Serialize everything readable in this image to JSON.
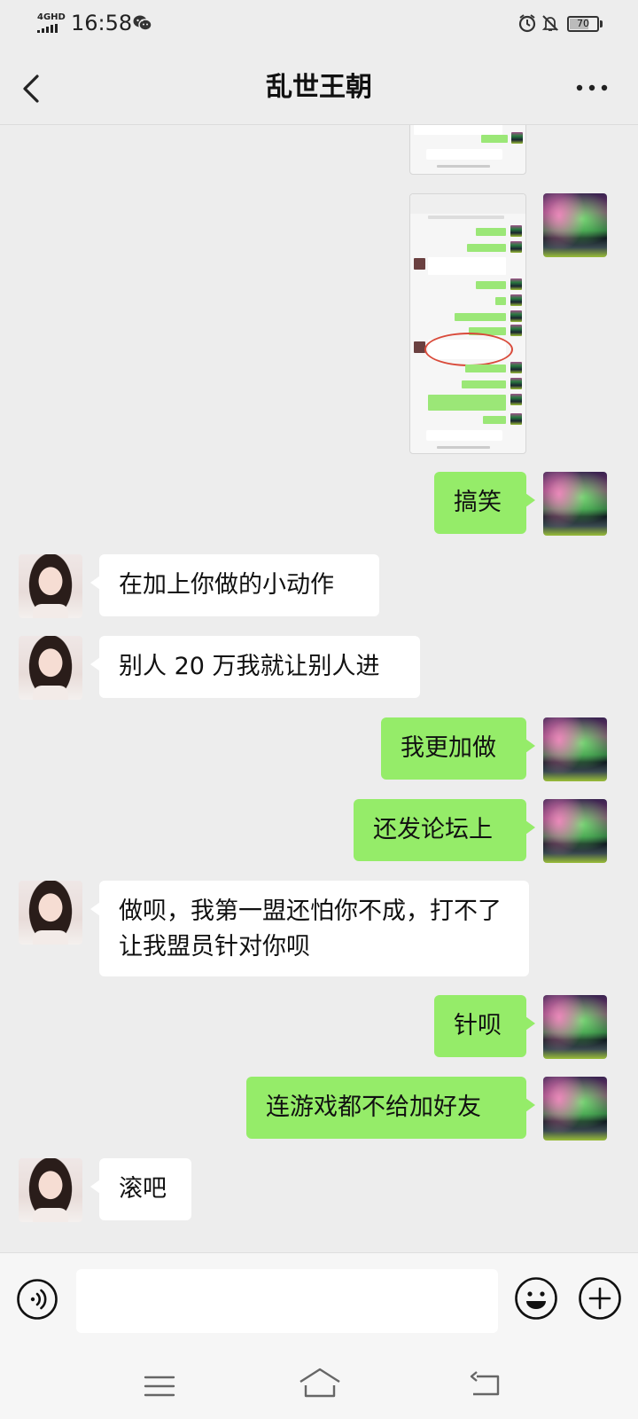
{
  "status_bar": {
    "network": "4GHD",
    "time": "16:58",
    "battery": "70",
    "battery_level": 0.7,
    "icons": [
      "signal-bars-icon",
      "wechat-notification-icon",
      "alarm-icon",
      "do-not-disturb-icon",
      "battery-icon"
    ]
  },
  "header": {
    "title": "乱世王朝",
    "back_icon": "chevron-left-icon",
    "more_icon": "more-dots-icon"
  },
  "messages": [
    {
      "sender": "me",
      "type": "image"
    },
    {
      "sender": "me",
      "type": "image"
    },
    {
      "sender": "me",
      "type": "text",
      "text": "搞笑"
    },
    {
      "sender": "other",
      "type": "text",
      "text": "在加上你做的小动作"
    },
    {
      "sender": "other",
      "type": "text",
      "text": "别人 20 万我就让别人进"
    },
    {
      "sender": "me",
      "type": "text",
      "text": "我更加做"
    },
    {
      "sender": "me",
      "type": "text",
      "text": "还发论坛上"
    },
    {
      "sender": "other",
      "type": "text",
      "text": "做呗，我第一盟还怕你不成，打不了让我盟员针对你呗"
    },
    {
      "sender": "me",
      "type": "text",
      "text": "针呗"
    },
    {
      "sender": "me",
      "type": "text",
      "text": "连游戏都不给加好友"
    },
    {
      "sender": "other",
      "type": "text",
      "text": "滚吧"
    }
  ],
  "input_bar": {
    "placeholder": "",
    "value": "",
    "icons": [
      "voice-icon",
      "emoji-icon",
      "plus-icon"
    ]
  },
  "system_nav": {
    "icons": [
      "menu-icon",
      "home-icon",
      "back-icon"
    ]
  },
  "colors": {
    "background": "#ededed",
    "my_bubble": "#95ec69",
    "their_bubble": "#ffffff"
  }
}
